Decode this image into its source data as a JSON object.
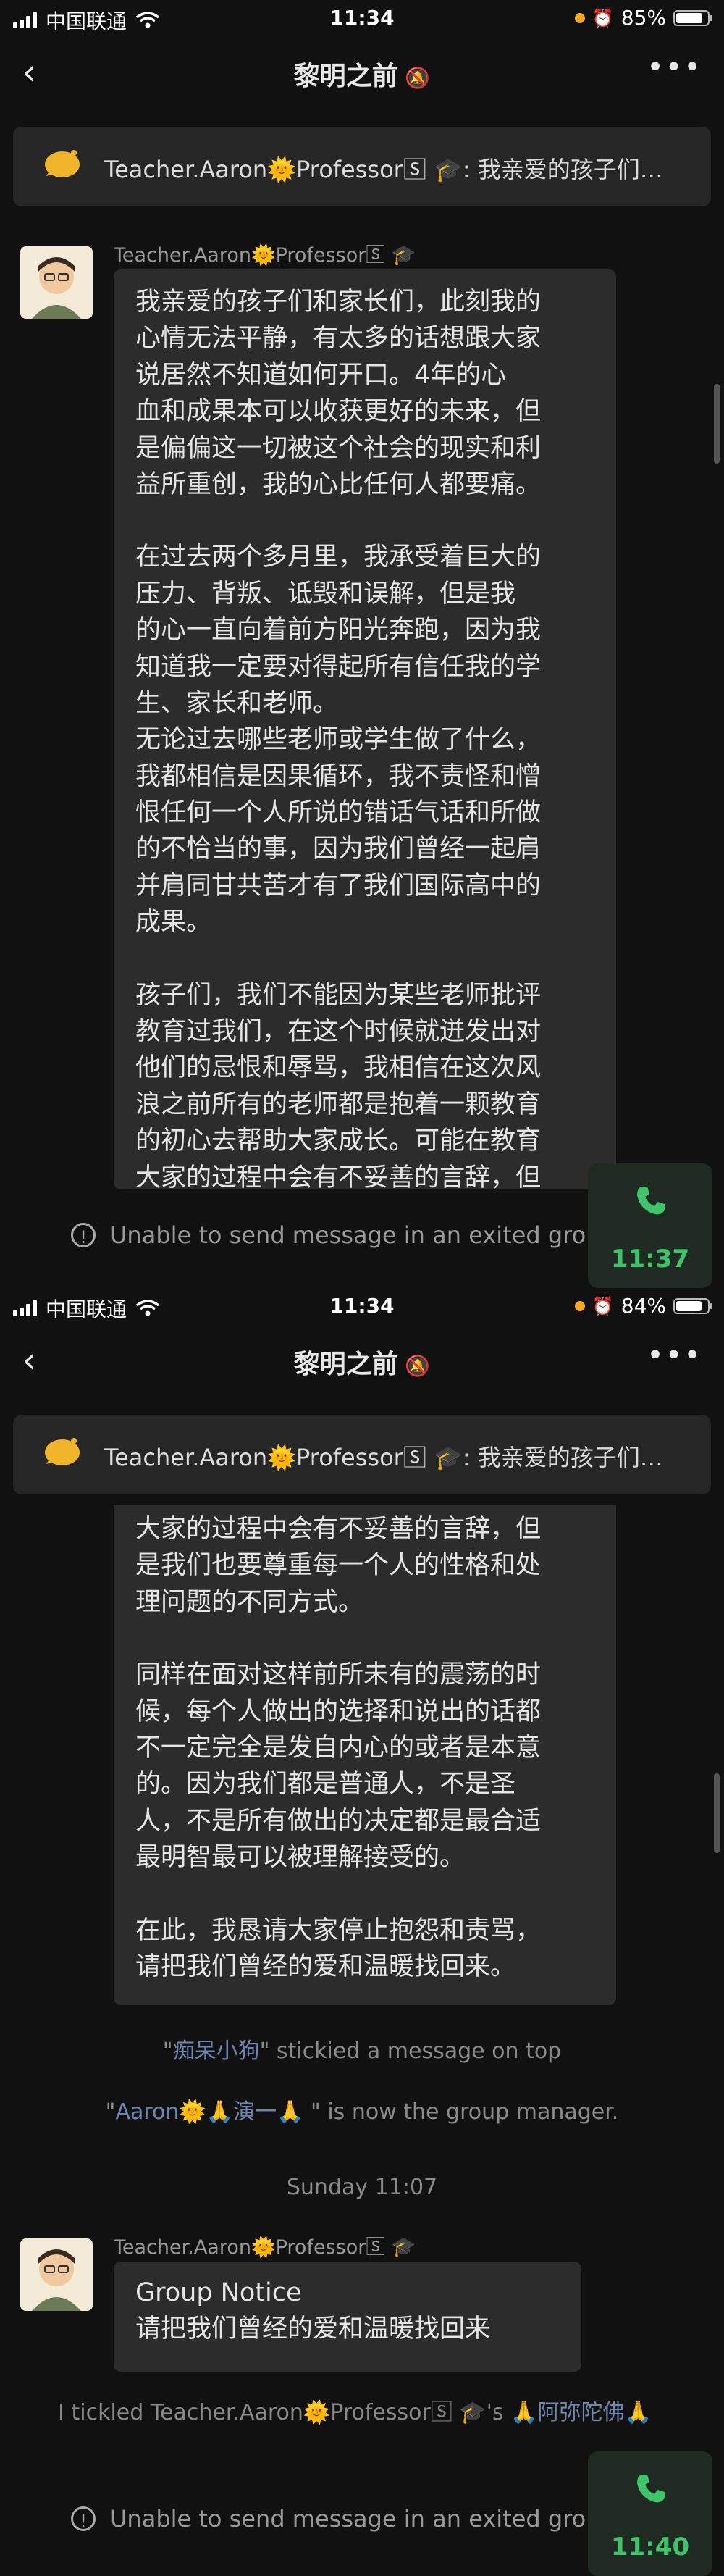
{
  "screens": [
    {
      "status": {
        "carrier": "中国联通",
        "time": "11:34",
        "battery": "85%",
        "battery_level": 0.85
      },
      "nav": {
        "title": "黎明之前",
        "back_icon": "chevron-left-icon",
        "more_icon": "more-icon",
        "mute_icon": "bell-slash-icon"
      },
      "pinned": {
        "text": "Teacher.Aaron🌞Professor🅂 🎓: 我亲爱的孩子们…"
      },
      "message": {
        "sender": "Teacher.Aaron🌞Professor🅂 🎓",
        "paragraphs": [
          "我亲爱的孩子们和家长们，此刻我的\n心情无法平静，有太多的话想跟大家\n说居然不知道如何开口。4年的心\n血和成果本可以收获更好的未来，但\n是偏偏这一切被这个社会的现实和利\n益所重创，我的心比任何人都要痛。",
          "在过去两个多月里，我承受着巨大的\n压力、背叛、诋毁和误解，但是我\n的心一直向着前方阳光奔跑，因为我\n知道我一定要对得起所有信任我的学\n生、家长和老师。\n无论过去哪些老师或学生做了什么，\n我都相信是因果循环，我不责怪和憎\n恨任何一个人所说的错话气话和所做\n的不恰当的事，因为我们曾经一起肩\n并肩同甘共苦才有了我们国际高中的\n成果。",
          "孩子们，我们不能因为某些老师批评\n教育过我们，在这个时候就迸发出对\n他们的忌恨和辱骂，我相信在这次风\n浪之前所有的老师都是抱着一颗教育\n的初心去帮助大家成长。可能在教育\n大家的过程中会有不妥善的言辞，但"
        ]
      },
      "input": {
        "warning": "Unable to send message in an exited group"
      },
      "call": {
        "time": "11:37"
      }
    },
    {
      "status": {
        "carrier": "中国联通",
        "time": "11:34",
        "battery": "84%",
        "battery_level": 0.84
      },
      "nav": {
        "title": "黎明之前",
        "back_icon": "chevron-left-icon",
        "more_icon": "more-icon",
        "mute_icon": "bell-slash-icon"
      },
      "pinned": {
        "text": "Teacher.Aaron🌞Professor🅂 🎓: 我亲爱的孩子们…"
      },
      "message_cont": {
        "paragraphs": [
          "大家的过程中会有不妥善的言辞，但\n是我们也要尊重每一个人的性格和处\n理问题的不同方式。",
          "同样在面对这样前所未有的震荡的时\n候，每个人做出的选择和说出的话都\n不一定完全是发自内心的或者是本意\n的。因为我们都是普通人，不是圣\n人，不是所有做出的决定都是最合适\n最明智最可以被理解接受的。",
          "在此，我恳请大家停止抱怨和责骂，\n请把我们曾经的爱和温暖找回来。"
        ]
      },
      "sys1": {
        "quote_open": "\"",
        "nick": "痴呆小狗",
        "rest": "\" stickied a message on top"
      },
      "sys2": {
        "quote_open": "\"",
        "nick": "Aaron🌞🙏演一🙏",
        "rest": " \" is now the group manager."
      },
      "timestamp": "Sunday 11:07",
      "notice": {
        "sender": "Teacher.Aaron🌞Professor🅂 🎓",
        "title": "Group Notice",
        "body": "请把我们曾经的爱和温暖找回来"
      },
      "tickle": {
        "prefix": "I  tickled Teacher.Aaron🌞Professor🅂 🎓's ",
        "nick": "🙏阿弥陀佛🙏"
      },
      "input": {
        "warning": "Unable to send message in an exited group"
      },
      "call": {
        "time": "11:40"
      }
    }
  ],
  "colors": {
    "background": "#111111",
    "bubble": "#2c2c2c",
    "call_green": "#3fc46a",
    "nick_blue": "#6f86b3"
  }
}
